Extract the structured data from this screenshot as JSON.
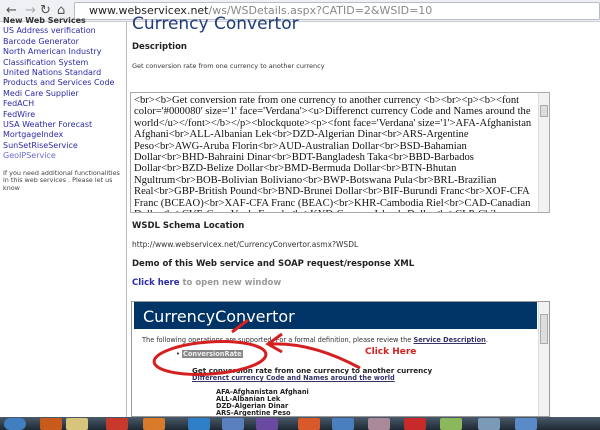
{
  "browser": {
    "url_host": "www.webservicex.net",
    "url_path": "/ws/WSDetails.aspx?CATID=2&WSID=10"
  },
  "sidebar": {
    "heading": "New Web Services",
    "items": [
      "US Address verification",
      "Barcode Generator",
      "North American Industry",
      "Classification System",
      "United Nations Standard",
      "Products and Services Code",
      "Medi Care Supplier",
      "FedACH",
      "FedWire",
      "USA Weather Forecast",
      "MortgageIndex",
      "SunSetRiseService",
      "GeoIPService"
    ],
    "footer": "If you need additional functionalities in this web services . Please let us know"
  },
  "main": {
    "title": "Currency Convertor",
    "description_heading": "Description",
    "description": "Get conversion rate from one currency to another currency",
    "textarea": "<br><b>Get conversion rate from one currency to another currency <b><br><p><b><font color='#000080' size='1' face='Verdana'><u>Differenct currency Code and Names around the world</u></font></b></p><blockquote><p><font face='Verdana' size='1'>AFA-Afghanistan Afghani<br>ALL-Albanian Lek<br>DZD-Algerian Dinar<br>ARS-Argentine Peso<br>AWG-Aruba Florin<br>AUD-Australian Dollar<br>BSD-Bahamian Dollar<br>BHD-Bahraini Dinar<br>BDT-Bangladesh Taka<br>BBD-Barbados Dollar<br>BZD-Belize Dollar<br>BMD-Bermuda Dollar<br>BTN-Bhutan Ngultrum<br>BOB-Bolivian Boliviano<br>BWP-Botswana Pula<br>BRL-Brazilian Real<br>GBP-British Pound<br>BND-Brunei Dollar<br>BIF-Burundi Franc<br>XOF-CFA Franc (BCEAO)<br>XAF-CFA Franc (BEAC)<br>KHR-Cambodia Riel<br>CAD-Canadian Dollar<br>CVE-Cape Verde Escudo<br>KYD-Cayman Islands Dollar<br>CLP-Chilean Peso<br>CNY-Chinese Yuan<br>COP-Colombian Peso<br>KMF-Comoros Franc<br>CRC-Costa Rica",
    "wsdl_heading": "WSDL Schema Location",
    "wsdl_url": "http://www.webservicex.net/CurrencyConvertor.asmx?WSDL",
    "demo_heading": "Demo of this Web service and SOAP request/response XML",
    "click_here": "Click here",
    "click_here_suffix": " to open new window"
  },
  "iframe": {
    "title": "CurrencyConvertor",
    "intro": "The following operations are supported. For a formal definition, please review the",
    "service_description": "Service Description",
    "intro_end": ".",
    "operation": "ConversionRate",
    "op_desc": "Get conversion rate from one currency to another currency",
    "op_link": "Differenct currency Code and Names around the world",
    "currencies": [
      "AFA-Afghanistan Afghani",
      "ALL-Albanian Lek",
      "DZD-Algerian Dinar",
      "ARS-Argentine Peso"
    ],
    "annotation": "Click Here",
    "annotation_color": "#d42020"
  }
}
